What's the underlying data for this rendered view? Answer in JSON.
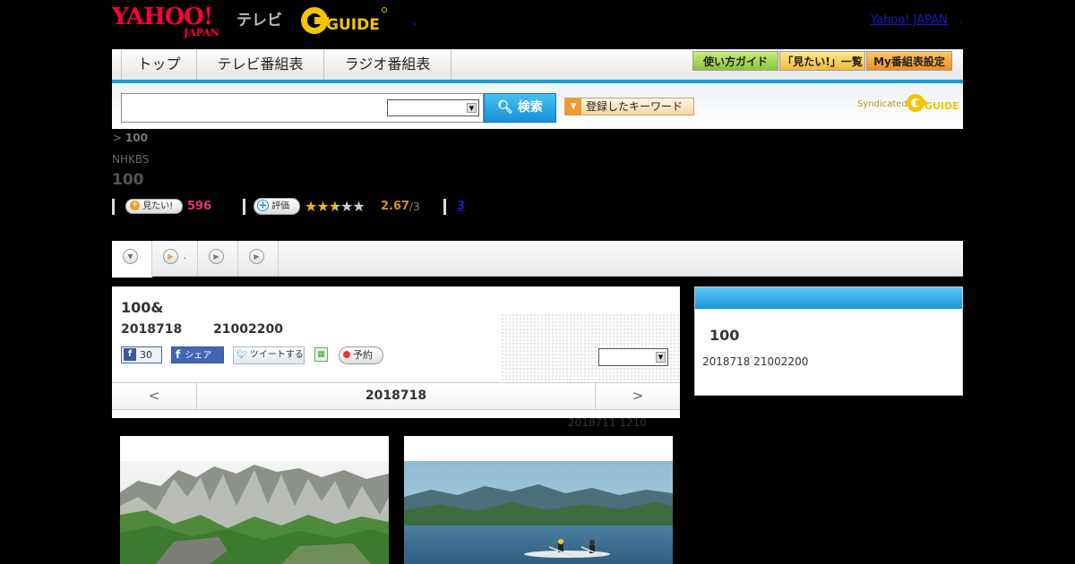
{
  "header": {
    "logo_yahoo": "YAHOO!",
    "logo_japan": "JAPAN",
    "logo_tv": "テレビ",
    "logo_gguide": "GUIDE",
    "yahoo_link": "Yahoo! JAPAN",
    "yahoo_link_suffix": "."
  },
  "nav": {
    "tabs": [
      "トップ",
      "テレビ番組表",
      "ラジオ番組表"
    ],
    "buttons": [
      "使い方ガイド",
      "「見たい!」一覧",
      "My番組表設定"
    ]
  },
  "search": {
    "input_value": "",
    "select_value": "",
    "button_label": "検索",
    "keyword_button": "登録したキーワード",
    "syndicated": "Syndicated"
  },
  "breadcrumb": {
    "prefix": ">",
    "current": "100"
  },
  "program": {
    "channel": "NHKBS",
    "title": "100"
  },
  "stats": {
    "mitai_label": "見たい!",
    "mitai_count": "596",
    "hyoka_label": "評価",
    "rating": "2.67",
    "rating_max": "/3",
    "rating_fraction": 0.534,
    "review_count": "3"
  },
  "tabs": {
    "tab2_label": "."
  },
  "episode": {
    "title": "100&",
    "date": "2018718",
    "time": "21002200",
    "fb_like_count": "30",
    "fb_share_label": "シェア",
    "tweet_label": "ツイートする",
    "reserve_label": "予約",
    "select_value": "",
    "nav_prev": "<",
    "nav_current": "2018718",
    "nav_next": ">"
  },
  "updated": "2018711  1210",
  "side": {
    "title": "100",
    "date": "2018718  21002200"
  },
  "colors": {
    "accent_blue": "#1d9ad9",
    "yahoo_red": "#ff0033",
    "mitai_pink": "#e6336b",
    "rating_orange": "#d58c24",
    "star_gold": "#f2b31c"
  },
  "icons": {
    "search": "search-icon",
    "keyword_caret": "caret-down-icon",
    "plus": "plus-icon",
    "star": "star-icon",
    "facebook": "facebook-icon",
    "twitter": "twitter-icon",
    "calendar": "calendar-icon",
    "record": "record-icon"
  }
}
